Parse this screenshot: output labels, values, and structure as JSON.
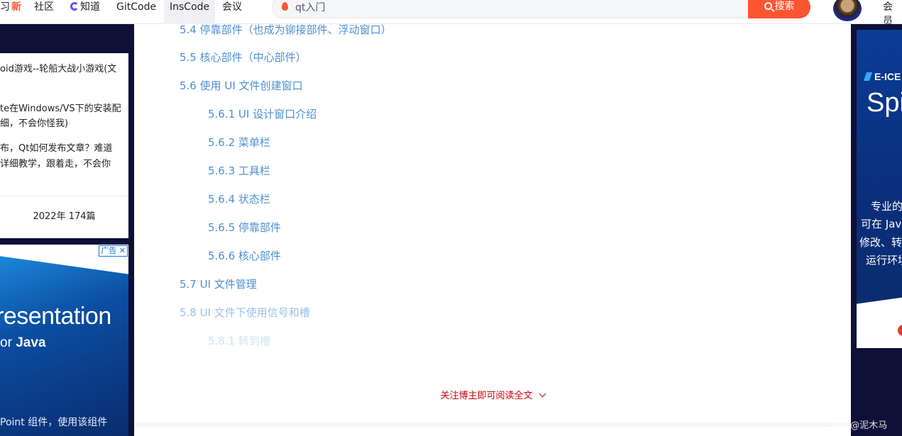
{
  "topbar": {
    "nav": [
      {
        "label": "习",
        "badge": "新"
      },
      {
        "label": "社区"
      },
      {
        "label": "知道"
      },
      {
        "label": "GitCode"
      },
      {
        "label": "InsCode"
      },
      {
        "label": "会议"
      }
    ],
    "search": {
      "value": "qt入门",
      "button_label": "搜索"
    },
    "vip_label": "会员"
  },
  "left_card": {
    "lines": [
      "oid游戏--轮船大战小游戏(文",
      "te在Windows/VS下的安装配",
      "细，不会你怪我)",
      "布，Qt如何发布文章？难道",
      "详细教学，跟着走，不会你"
    ],
    "summary": "2022年  174篇"
  },
  "left_ad": {
    "badge": "广告",
    "headline": "resentation",
    "subline_prefix": "or",
    "subline_bold": "Java",
    "desc": "Point 组件，使用该组件"
  },
  "toc": [
    {
      "label": "5.4 停靠部件（也成为铆接部件、浮动窗口）",
      "level": 1
    },
    {
      "label": "5.5 核心部件（中心部件）",
      "level": 1
    },
    {
      "label": "5.6 使用 UI 文件创建窗口",
      "level": 1
    },
    {
      "label": "5.6.1 UI 设计窗口介绍",
      "level": 2
    },
    {
      "label": "5.6.2 菜单栏",
      "level": 2
    },
    {
      "label": "5.6.3 工具栏",
      "level": 2
    },
    {
      "label": "5.6.4 状态栏",
      "level": 2
    },
    {
      "label": "5.6.5 停靠部件",
      "level": 2
    },
    {
      "label": "5.6.6 核心部件",
      "level": 2
    },
    {
      "label": "5.7 UI 文件管理",
      "level": 1
    },
    {
      "label": "5.8 UI 文件下使用信号和槽",
      "level": 1
    },
    {
      "label": "5.8.1 转到槽",
      "level": 2
    }
  ],
  "read_more": "关注博主即可阅读全文",
  "right_ad": {
    "brand": "E-ICE",
    "brand2": "Spi",
    "lines": [
      "专业的",
      "可在 Jav",
      "修改、转",
      "运行环境"
    ]
  },
  "watermark": "CSDN @泥木马"
}
